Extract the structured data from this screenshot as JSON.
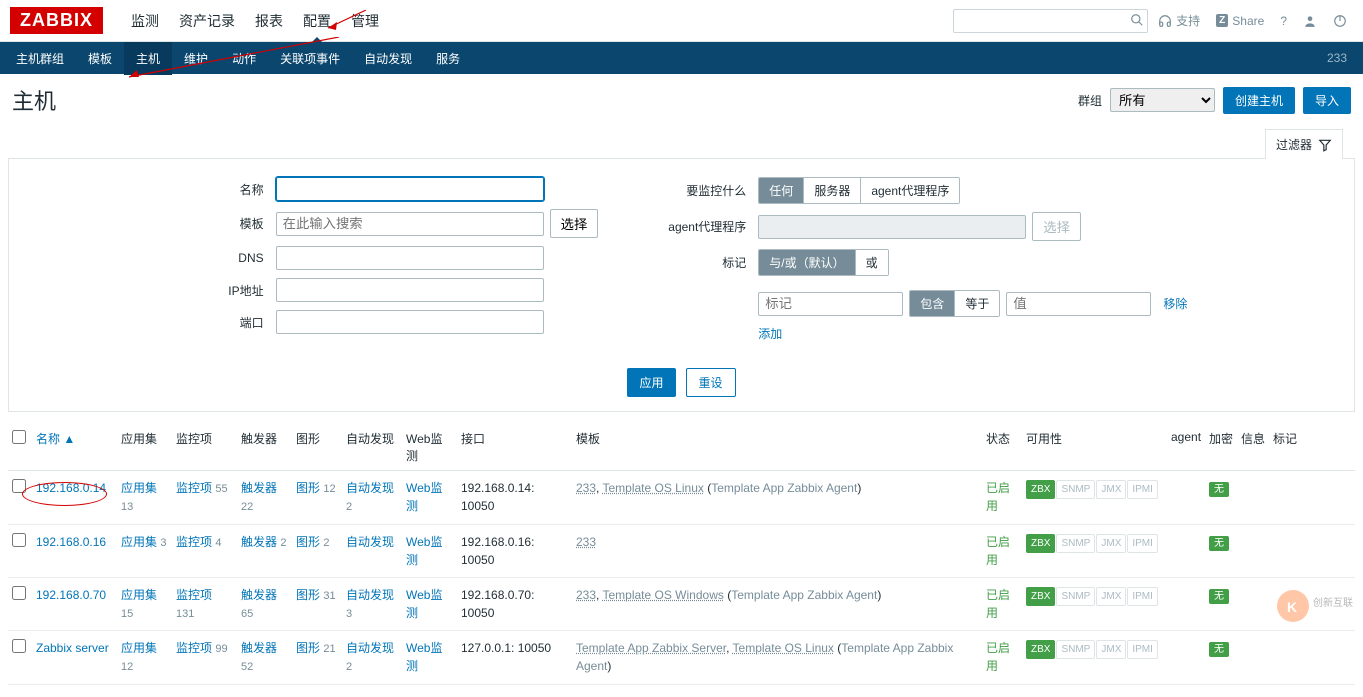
{
  "logo": "ZABBIX",
  "top_nav": [
    "监测",
    "资产记录",
    "报表",
    "配置",
    "管理"
  ],
  "top_nav_active": 3,
  "support_label": "支持",
  "share_label": "Share",
  "sub_nav": [
    "主机群组",
    "模板",
    "主机",
    "维护",
    "动作",
    "关联项事件",
    "自动发现",
    "服务"
  ],
  "sub_nav_active": 2,
  "sub_nav_badge": "233",
  "page_title": "主机",
  "group_label": "群组",
  "group_selected": "所有",
  "btn_create": "创建主机",
  "btn_import": "导入",
  "filter_tab": "过滤器",
  "filter": {
    "name_label": "名称",
    "template_label": "模板",
    "template_placeholder": "在此输入搜索",
    "select_btn": "选择",
    "dns_label": "DNS",
    "ip_label": "IP地址",
    "port_label": "端口",
    "monitor_label": "要监控什么",
    "monitor_opts": [
      "任何",
      "服务器",
      "agent代理程序"
    ],
    "proxy_label": "agent代理程序",
    "tags_label": "标记",
    "tags_mode_opts": [
      "与/或（默认）",
      "或"
    ],
    "tag_name_ph": "标记",
    "tag_op_opts": [
      "包含",
      "等于"
    ],
    "tag_val_ph": "值",
    "remove_link": "移除",
    "add_link": "添加",
    "apply_btn": "应用",
    "reset_btn": "重设"
  },
  "columns": {
    "name": "名称",
    "apps": "应用集",
    "items": "监控项",
    "triggers": "触发器",
    "graphs": "图形",
    "discovery": "自动发现",
    "web": "Web监测",
    "interface": "接口",
    "templates": "模板",
    "status": "状态",
    "availability": "可用性",
    "proxy": "agent",
    "encryption": "加密",
    "info": "信息",
    "tags": "标记"
  },
  "rows": [
    {
      "name": "192.168.0.14",
      "apps": {
        "label": "应用集",
        "count": 13
      },
      "items": {
        "label": "监控项",
        "count": 55
      },
      "triggers": {
        "label": "触发器",
        "count": 22
      },
      "graphs": {
        "label": "图形",
        "count": 12
      },
      "discovery": {
        "label": "自动发现",
        "count": 2
      },
      "web": "Web监测",
      "interface": "192.168.0.14: 10050",
      "templates": [
        {
          "t": "233",
          "linked": true
        },
        {
          "t": ", "
        },
        {
          "t": "Template OS Linux",
          "linked": true
        },
        {
          "t": " ("
        },
        {
          "t": "Template App Zabbix Agent",
          "sub": true
        },
        {
          "t": ")"
        }
      ],
      "status": "已启用",
      "avail": [
        "ZBX",
        "SNMP",
        "JMX",
        "IPMI"
      ],
      "enc": "无"
    },
    {
      "name": "192.168.0.16",
      "circled": true,
      "apps": {
        "label": "应用集",
        "count": 3
      },
      "items": {
        "label": "监控项",
        "count": 4
      },
      "triggers": {
        "label": "触发器",
        "count": 2
      },
      "graphs": {
        "label": "图形",
        "count": 2
      },
      "discovery": {
        "label": "自动发现",
        "count": null
      },
      "web": "Web监测",
      "interface": "192.168.0.16: 10050",
      "templates": [
        {
          "t": "233",
          "linked": true
        }
      ],
      "status": "已启用",
      "avail": [
        "ZBX",
        "SNMP",
        "JMX",
        "IPMI"
      ],
      "enc": "无"
    },
    {
      "name": "192.168.0.70",
      "apps": {
        "label": "应用集",
        "count": 15
      },
      "items": {
        "label": "监控项",
        "count": 131
      },
      "triggers": {
        "label": "触发器",
        "count": 65
      },
      "graphs": {
        "label": "图形",
        "count": 31
      },
      "discovery": {
        "label": "自动发现",
        "count": 3
      },
      "web": "Web监测",
      "interface": "192.168.0.70: 10050",
      "templates": [
        {
          "t": "233",
          "linked": true
        },
        {
          "t": ", "
        },
        {
          "t": "Template OS Windows",
          "linked": true
        },
        {
          "t": " ("
        },
        {
          "t": "Template App Zabbix Agent",
          "sub": true
        },
        {
          "t": ")"
        }
      ],
      "status": "已启用",
      "avail": [
        "ZBX",
        "SNMP",
        "JMX",
        "IPMI"
      ],
      "enc": "无"
    },
    {
      "name": "Zabbix server",
      "apps": {
        "label": "应用集",
        "count": 12
      },
      "items": {
        "label": "监控项",
        "count": 99
      },
      "triggers": {
        "label": "触发器",
        "count": 52
      },
      "graphs": {
        "label": "图形",
        "count": 21
      },
      "discovery": {
        "label": "自动发现",
        "count": 2
      },
      "web": "Web监测",
      "interface": "127.0.0.1: 10050",
      "templates": [
        {
          "t": "Template App Zabbix Server",
          "linked": true
        },
        {
          "t": ", "
        },
        {
          "t": "Template OS Linux",
          "linked": true
        },
        {
          "t": " ("
        },
        {
          "t": "Template App Zabbix Agent",
          "sub": true
        },
        {
          "t": ")"
        }
      ],
      "status": "已启用",
      "avail": [
        "ZBX",
        "SNMP",
        "JMX",
        "IPMI"
      ],
      "enc": "无"
    }
  ]
}
